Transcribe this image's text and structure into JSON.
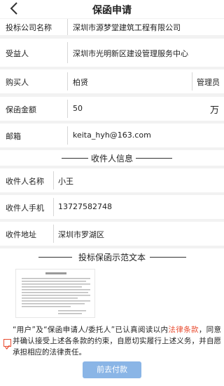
{
  "header": {
    "title": "保函申请"
  },
  "form": {
    "company_label": "投标公司名称",
    "company_value": "深圳市源梦堂建筑工程有限公司",
    "beneficiary_label": "受益人",
    "beneficiary_value": "深圳市光明新区建设管理服务中心",
    "buyer_label": "购买人",
    "buyer_value": "柏贤",
    "buyer_role": "管理员",
    "amount_label": "保函金额",
    "amount_value": "50",
    "amount_unit": "万",
    "email_label": "邮箱",
    "email_value": "keita_hyh@163.com"
  },
  "recipient": {
    "section_title": "收件人信息",
    "name_label": "收件人名称",
    "name_value": "小王",
    "phone_label": "收件人手机",
    "phone_value": "13727582748",
    "address_label": "收件地址",
    "address_value": "深圳市罗湖区"
  },
  "sample": {
    "section_title": "投标保函示范文本"
  },
  "agreement": {
    "text_before": "“用户”及“保函申请人/委托人”已认真阅读以内",
    "link_text": "法律条款",
    "text_after": "，同意并确认接受上述各条款的约束，自愿切实履行上述义务，并自愿承担相应的法律责任。",
    "checked": true
  },
  "actions": {
    "pay_label": "前去付款"
  },
  "colors": {
    "accent": "#e84a2e",
    "button": "#8ab5e6"
  }
}
